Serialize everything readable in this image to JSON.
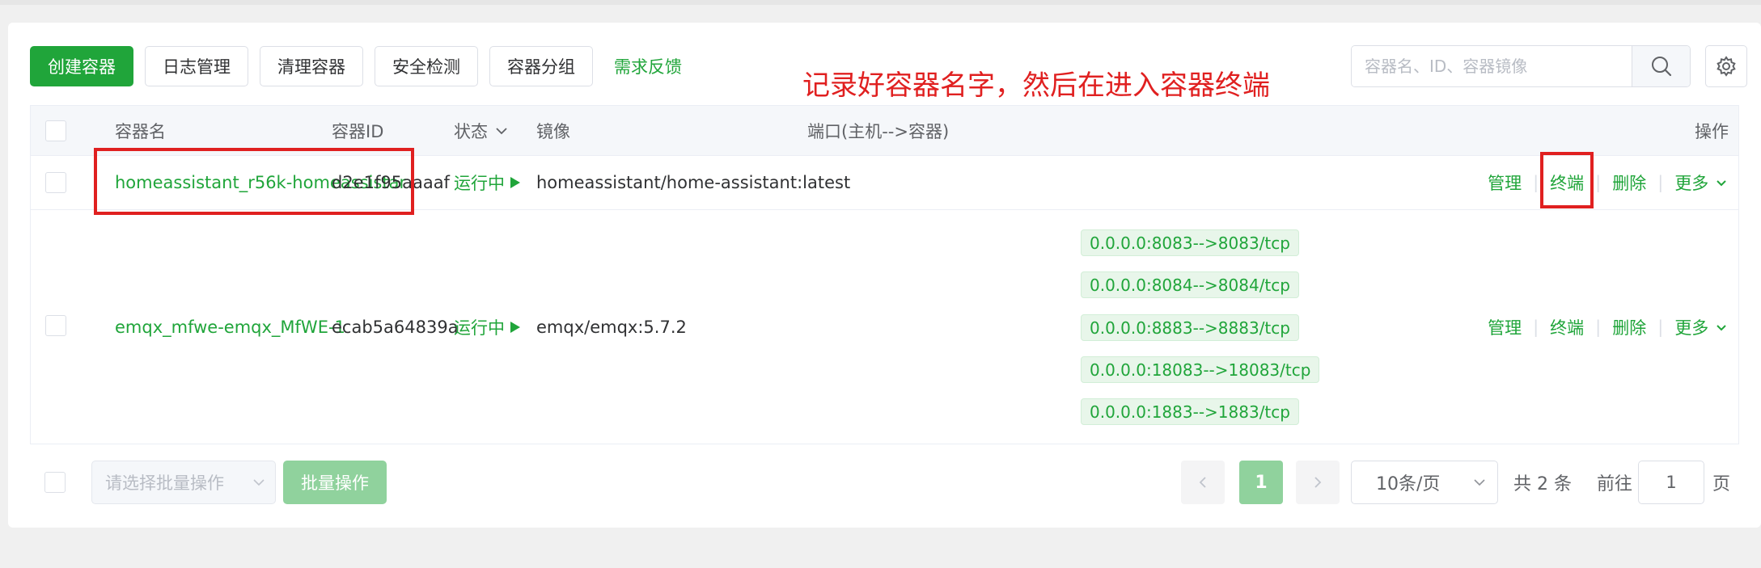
{
  "toolbar": {
    "create": "创建容器",
    "logs": "日志管理",
    "clean": "清理容器",
    "security": "安全检测",
    "group": "容器分组",
    "feedback": "需求反馈"
  },
  "annotation": "记录好容器名字，然后在进入容器终端",
  "search": {
    "placeholder": "容器名、ID、容器镜像"
  },
  "table": {
    "headers": {
      "name": "容器名",
      "id": "容器ID",
      "status": "状态",
      "image": "镜像",
      "ports": "端口(主机-->容器)",
      "ops": "操作"
    },
    "rows": [
      {
        "name": "homeassistant_r56k-homeassistant_",
        "id": "d2e1f95aaaaf",
        "status": "运行中",
        "image": "homeassistant/home-assistant:latest",
        "ports": []
      },
      {
        "name": "emqx_mfwe-emqx_MfWE-1",
        "id": "ecab5a64839a",
        "status": "运行中",
        "image": "emqx/emqx:5.7.2",
        "ports": [
          "0.0.0.0:8083-->8083/tcp",
          "0.0.0.0:8084-->8084/tcp",
          "0.0.0.0:8883-->8883/tcp",
          "0.0.0.0:18083-->18083/tcp",
          "0.0.0.0:1883-->1883/tcp"
        ]
      }
    ],
    "ops": {
      "manage": "管理",
      "terminal": "终端",
      "delete": "删除",
      "more": "更多"
    }
  },
  "footer": {
    "batch_select_placeholder": "请选择批量操作",
    "batch_button": "批量操作",
    "current_page": "1",
    "page_size": "10条/页",
    "total": "共 2 条",
    "goto_label": "前往",
    "goto_value": "1",
    "page_unit": "页"
  },
  "colors": {
    "accent": "#20a53a",
    "annotation": "#e02020"
  }
}
